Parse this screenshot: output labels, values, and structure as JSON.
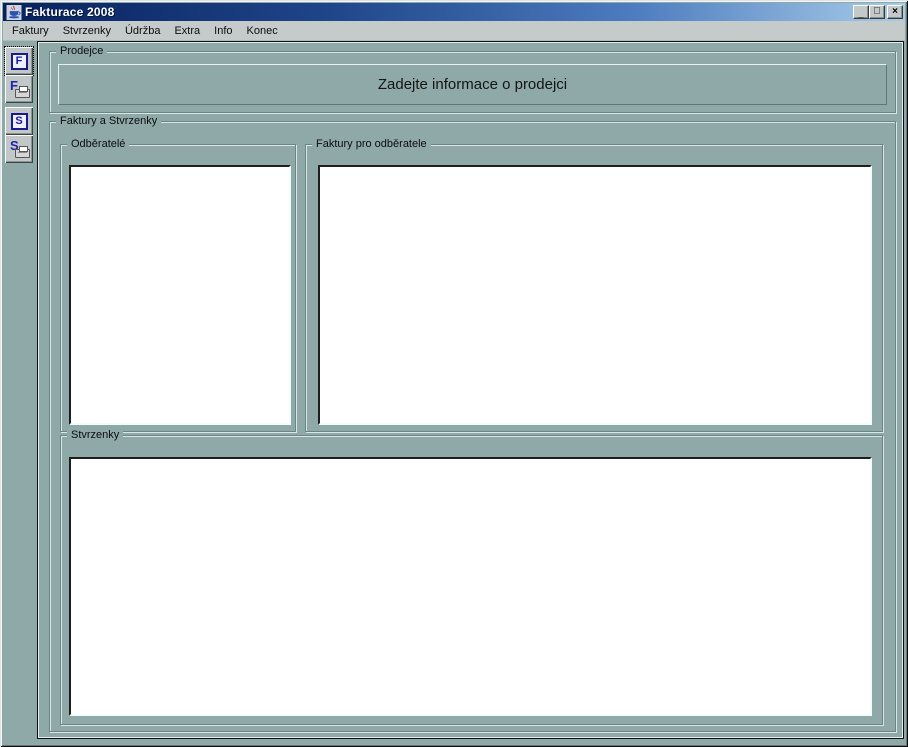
{
  "window": {
    "title": "Fakturace 2008",
    "controls": {
      "minimize": "_",
      "maximize": "□",
      "close": "×"
    }
  },
  "menu": {
    "items": [
      "Faktury",
      "Stvrzenky",
      "Údržba",
      "Extra",
      "Info",
      "Konec"
    ]
  },
  "toolbar": {
    "buttons": [
      {
        "name": "faktury-button",
        "letter": "F",
        "has_printer": false
      },
      {
        "name": "faktury-print-button",
        "letter": "F",
        "has_printer": true
      },
      {
        "name": "stvrzenky-button",
        "letter": "S",
        "has_printer": false
      },
      {
        "name": "stvrzenky-print-button",
        "letter": "S",
        "has_printer": true
      }
    ]
  },
  "main": {
    "prodejce": {
      "label": "Prodejce",
      "message": "Zadejte informace o prodejci"
    },
    "faktury_a_stvrzenky": {
      "label": "Faktury a Stvrzenky",
      "odberatele": {
        "label": "Odběratelé",
        "items": []
      },
      "faktury_pro_odberatele": {
        "label": "Faktury pro odběratele",
        "items": []
      },
      "stvrzenky": {
        "label": "Stvrzenky",
        "items": []
      }
    }
  },
  "colors": {
    "content_bg": "#8fa9a9",
    "titlebar_start": "#08215e",
    "titlebar_end": "#a8cce8",
    "menubar_bg": "#c5caca",
    "listbox_bg": "#ffffff",
    "icon_navy": "#1a1a8c"
  }
}
